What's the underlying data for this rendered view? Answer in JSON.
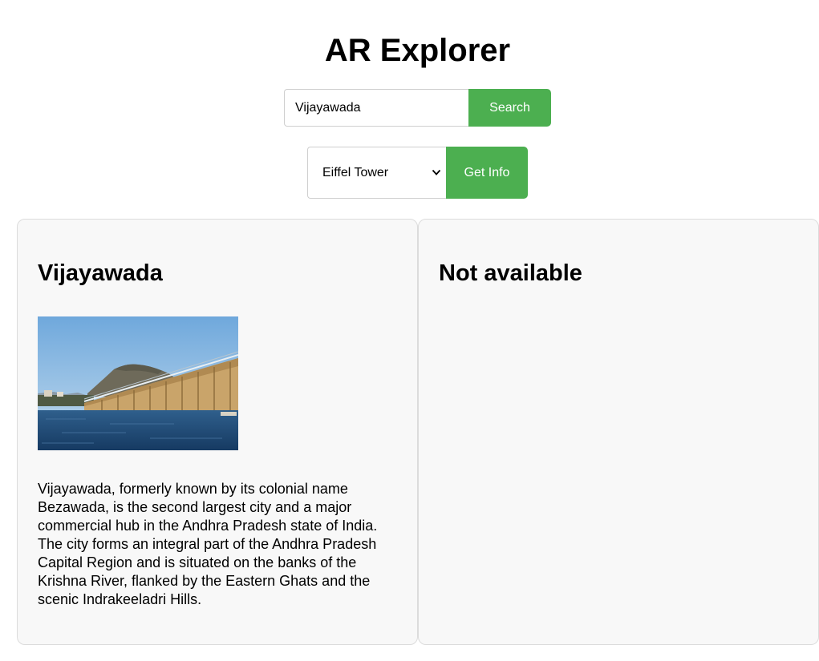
{
  "header": {
    "title": "AR Explorer"
  },
  "search": {
    "value": "Vijayawada",
    "button_label": "Search"
  },
  "place_selector": {
    "selected": "Eiffel Tower",
    "button_label": "Get Info"
  },
  "left_panel": {
    "heading": "Vijayawada",
    "image_alt": "Vijayawada",
    "description": "Vijayawada, formerly known by its colonial name Bezawada, is the second largest city and a major commercial hub in the Andhra Pradesh state of India. The city forms an integral part of the Andhra Pradesh Capital Region and is situated on the banks of the Krishna River, flanked by the Eastern Ghats and the scenic Indrakeeladri Hills."
  },
  "right_panel": {
    "heading": "Not available"
  },
  "colors": {
    "accent": "#4caf50",
    "panel_bg": "#f8f8f8",
    "panel_border": "#dcdcdc"
  },
  "icons": {
    "select_arrow": "chevron-down-icon"
  }
}
